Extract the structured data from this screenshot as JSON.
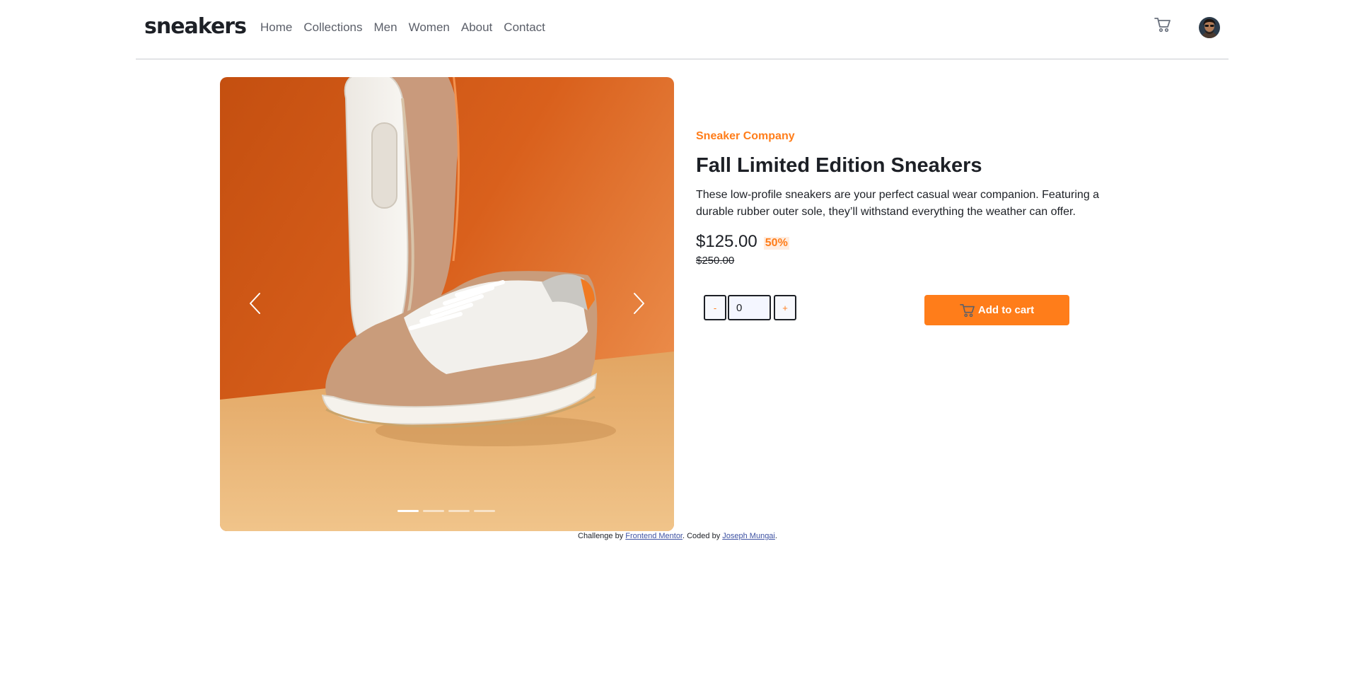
{
  "header": {
    "logo": "sneakers",
    "nav": [
      "Home",
      "Collections",
      "Men",
      "Women",
      "About",
      "Contact"
    ]
  },
  "product": {
    "company": "Sneaker Company",
    "title": "Fall Limited Edition Sneakers",
    "description": "These low-profile sneakers are your perfect casual wear companion. Featuring a durable rubber outer sole, they’ll withstand everything the weather can offer.",
    "price": "$125.00",
    "discount": "50%",
    "original_price": "$250.00"
  },
  "gallery": {
    "image_count": 4,
    "active_index": 0
  },
  "quantity": {
    "minus_label": "-",
    "plus_label": "+",
    "value": "0"
  },
  "actions": {
    "add_to_cart": "Add to cart"
  },
  "attribution": {
    "prefix": "Challenge by ",
    "challenge_link": "Frontend Mentor",
    "middle": ". Coded by ",
    "author_link": "Joseph Mungai",
    "suffix": "."
  },
  "colors": {
    "accent": "#ff7d1a",
    "accent_light": "#ffede0",
    "text_dark": "#1d2026",
    "text_muted": "#5b5f69",
    "link": "#3e52a3"
  },
  "icons": {
    "cart": "cart-icon",
    "avatar": "avatar",
    "prev": "chevron-left-icon",
    "next": "chevron-right-icon"
  }
}
